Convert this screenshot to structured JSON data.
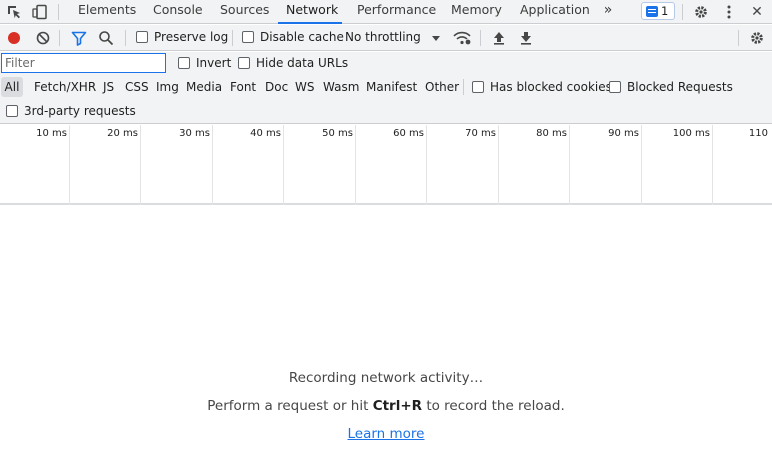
{
  "tabs": [
    {
      "label": "Elements"
    },
    {
      "label": "Console"
    },
    {
      "label": "Sources"
    },
    {
      "label": "Network",
      "active": true
    },
    {
      "label": "Performance"
    },
    {
      "label": "Memory"
    },
    {
      "label": "Application"
    }
  ],
  "tabbar": {
    "more_tabs_glyph": "»",
    "issues_count": "1",
    "close_glyph": "✕"
  },
  "toolbar": {
    "preserve_log": "Preserve log",
    "disable_cache": "Disable cache",
    "throttling": "No throttling"
  },
  "filter": {
    "placeholder": "Filter",
    "invert": "Invert",
    "hide_data_urls": "Hide data URLs",
    "types": [
      "All",
      "Fetch/XHR",
      "JS",
      "CSS",
      "Img",
      "Media",
      "Font",
      "Doc",
      "WS",
      "Wasm",
      "Manifest",
      "Other"
    ],
    "has_blocked_cookies": "Has blocked cookies",
    "blocked_requests": "Blocked Requests",
    "third_party": "3rd-party requests"
  },
  "timeline": {
    "ticks": [
      "10 ms",
      "20 ms",
      "30 ms",
      "40 ms",
      "50 ms",
      "60 ms",
      "70 ms",
      "80 ms",
      "90 ms",
      "100 ms",
      "110"
    ]
  },
  "empty_state": {
    "line1": "Recording network activity…",
    "line2_before": "Perform a request or hit ",
    "line2_shortcut": "Ctrl+R",
    "line2_after": " to record the reload.",
    "learn_more": "Learn more"
  },
  "colors": {
    "accent": "#1a73e8",
    "record": "#d93025",
    "toolbar_bg": "#f1f3f4"
  },
  "icons": [
    "inspect-element-icon",
    "device-toolbar-icon",
    "issues-chat-icon",
    "settings-gear-icon",
    "kebab-menu-icon",
    "close-icon",
    "record-icon",
    "clear-icon",
    "filter-funnel-icon",
    "search-icon",
    "dropdown-caret-icon",
    "network-conditions-icon",
    "import-har-icon",
    "export-har-icon"
  ]
}
